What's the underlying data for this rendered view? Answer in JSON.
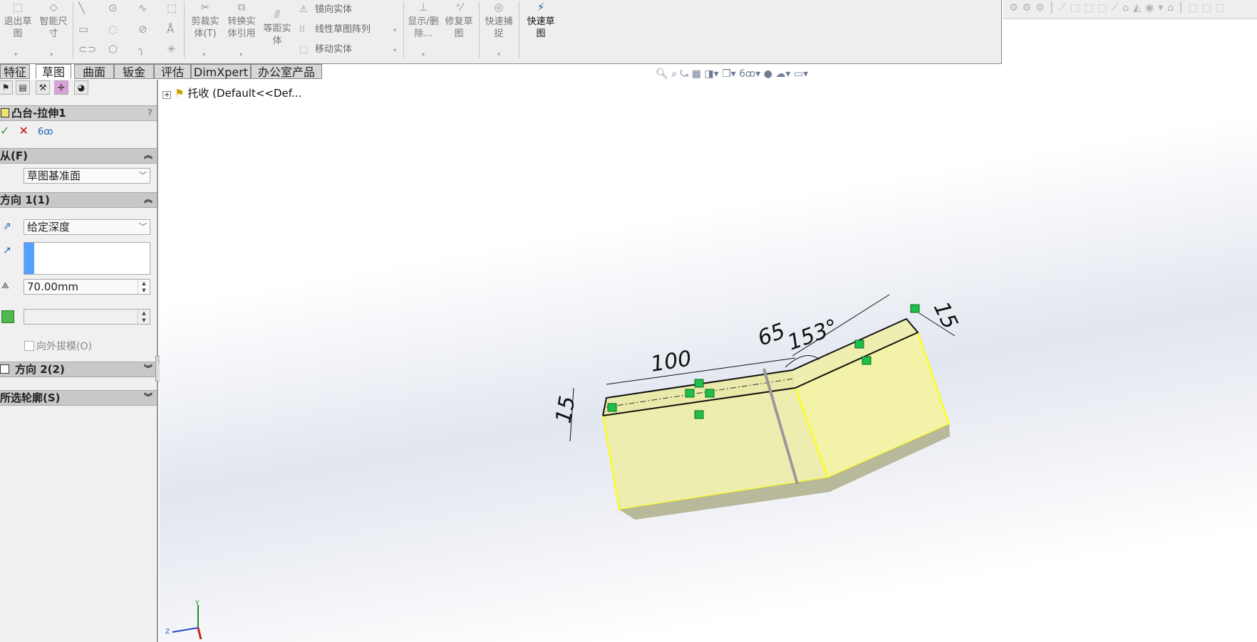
{
  "ribbon": {
    "exit_sketch": "退出草图",
    "smart_dim": "智能尺寸",
    "trim": "剪裁实体(T)",
    "convert": "转换实体引用",
    "offset": "等距实体",
    "mirror": "镜向实体",
    "linear_pattern": "线性草图阵列",
    "move": "移动实体",
    "display_delete": "显示/删除...",
    "repair": "修复草图",
    "quick_snaps": "快速捕捉",
    "rapid_sketch": "快速草图"
  },
  "tabs": [
    "特征",
    "草图",
    "曲面",
    "钣金",
    "评估",
    "DimXpert",
    "办公室产品"
  ],
  "active_tab": "草图",
  "panel": {
    "title": "凸台-拉伸1",
    "help": "?",
    "from_label": "从(F)",
    "from_value": "草图基准面",
    "dir1_label": "方向 1(1)",
    "end_condition": "给定深度",
    "depth": "70.00mm",
    "draft_outward": "向外拔模(O)",
    "dir2_label": "方向 2(2)",
    "contours_label": "所选轮廓(S)"
  },
  "tree": {
    "root": "托收 (Default<<Def..."
  },
  "dims": {
    "left": "15",
    "length": "100",
    "short": "65",
    "angle": "153°",
    "right": "15"
  },
  "axis": {
    "y": "Y",
    "z": "Z"
  },
  "colors": {
    "part_face": "#f0f0a8",
    "part_side": "#e8e8a0",
    "part_edge": "#ffff00",
    "dark_side": "#a8a88a",
    "accent": "#1d5fb8"
  },
  "icons": [
    "line-icon",
    "circle-icon",
    "spline-icon",
    "rectangle-icon",
    "arc-icon",
    "fillet-icon",
    "point-icon",
    "zoom-icon",
    "view-orientation-icon"
  ]
}
